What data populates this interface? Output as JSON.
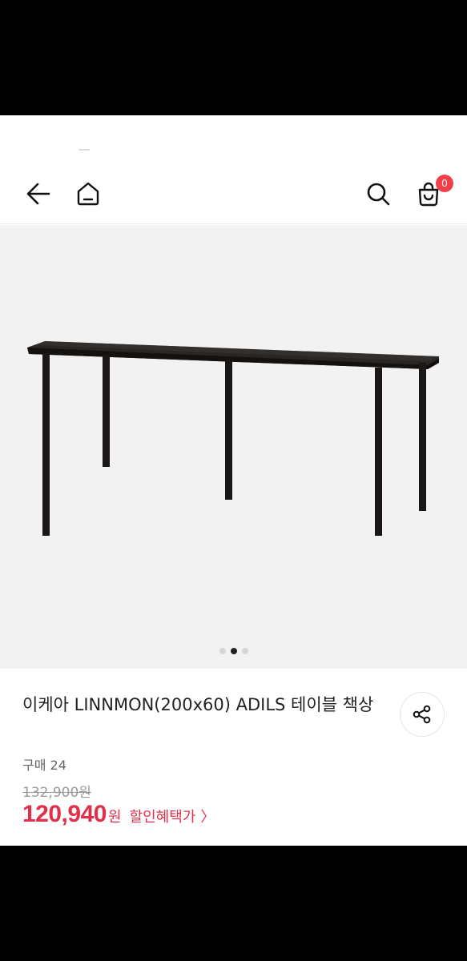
{
  "header": {
    "back_icon": "arrow-left-icon",
    "home_icon": "home-icon",
    "search_icon": "search-icon",
    "cart_icon": "shopping-bag-icon",
    "cart_count": "0"
  },
  "gallery": {
    "slide_count": 3,
    "active_index": 1
  },
  "product": {
    "title": "이케아 LINNMON(200x60) ADILS 테이블 책상",
    "purchase_count": "구매 24",
    "original_price": "132,900원",
    "sale_price": "120,940",
    "currency": "원",
    "discount_label": "할인혜택가",
    "chevron": "〉",
    "share_icon": "share-icon"
  },
  "colors": {
    "accent": "#e2304a",
    "badge": "#f0404a"
  }
}
